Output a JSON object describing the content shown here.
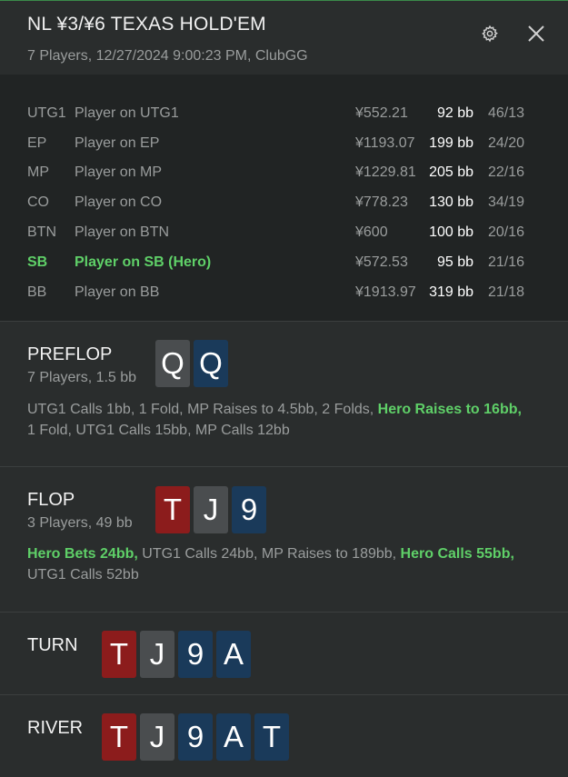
{
  "header": {
    "title": "NL ¥3/¥6 TEXAS HOLD'EM",
    "subtitle": "7 Players, 12/27/2024 9:00:23 PM, ClubGG"
  },
  "players": [
    {
      "pos": "UTG1",
      "name": "Player on UTG1",
      "stack": "¥552.21",
      "bb": "92 bb",
      "stat": "46/13"
    },
    {
      "pos": "EP",
      "name": "Player on EP",
      "stack": "¥1193.07",
      "bb": "199 bb",
      "stat": "24/20"
    },
    {
      "pos": "MP",
      "name": "Player on MP",
      "stack": "¥1229.81",
      "bb": "205 bb",
      "stat": "22/16"
    },
    {
      "pos": "CO",
      "name": "Player on CO",
      "stack": "¥778.23",
      "bb": "130 bb",
      "stat": "34/19"
    },
    {
      "pos": "BTN",
      "name": "Player on BTN",
      "stack": "¥600",
      "bb": "100 bb",
      "stat": "20/16"
    },
    {
      "pos": "SB",
      "name": "Player on SB (Hero)",
      "stack": "¥572.53",
      "bb": "95 bb",
      "stat": "21/16"
    },
    {
      "pos": "BB",
      "name": "Player on BB",
      "stack": "¥1913.97",
      "bb": "319 bb",
      "stat": "21/18"
    }
  ],
  "preflop": {
    "title": "PREFLOP",
    "sub": "7 Players, 1.5 bb",
    "cards": [
      "Q",
      "Q"
    ],
    "actions_1": "UTG1 Calls 1bb, 1 Fold, MP Raises to 4.5bb, 2 Folds, ",
    "hero_1": "Hero Raises to 16bb,",
    "actions_2": "1 Fold, UTG1 Calls 15bb, MP Calls 12bb"
  },
  "flop": {
    "title": "FLOP",
    "sub": "3 Players, 49 bb",
    "cards": [
      "T",
      "J",
      "9"
    ],
    "hero_1": "Hero Bets 24bb,",
    "actions_1": " UTG1 Calls 24bb, MP Raises to 189bb, ",
    "hero_2": "Hero Calls 55bb,",
    "actions_2": "UTG1 Calls 52bb"
  },
  "turn": {
    "title": "TURN",
    "cards": [
      "T",
      "J",
      "9",
      "A"
    ]
  },
  "river": {
    "title": "RIVER",
    "cards": [
      "T",
      "J",
      "9",
      "A",
      "T"
    ]
  },
  "colors": {
    "hero": "#5fd068",
    "heart": "#8c1c1c",
    "spade": "#4a4d4f",
    "club": "#1a3a5a"
  }
}
